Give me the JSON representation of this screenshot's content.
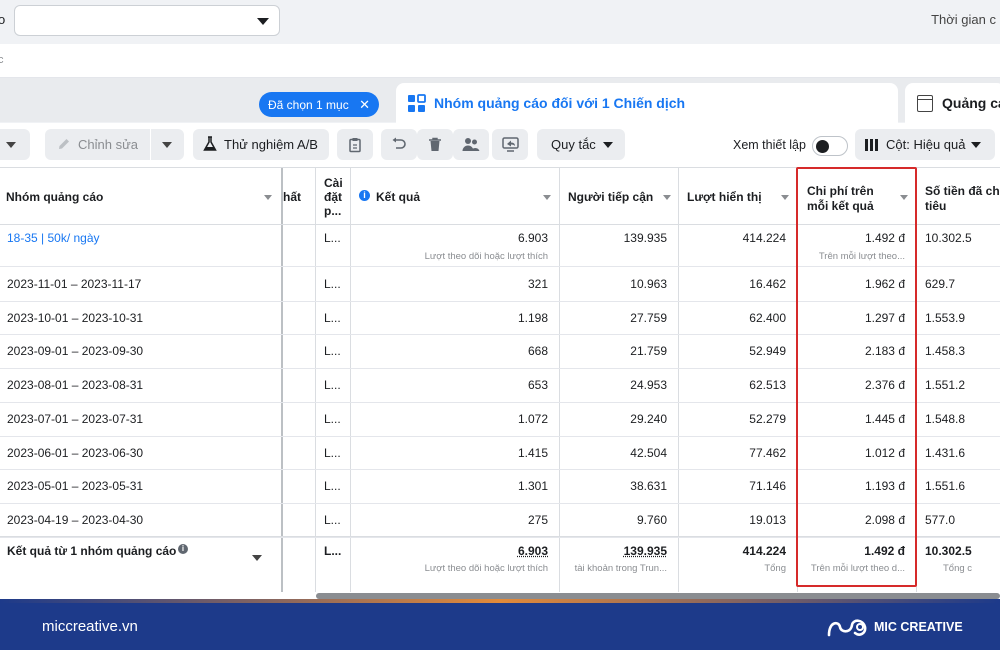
{
  "filter_bar": {
    "left_label": "o",
    "time_label": "Thời gian c",
    "sub_text": "c"
  },
  "tabs": {
    "chip_label": "Đã chọn 1 mục",
    "chip_close": "✕",
    "active_tab": "Nhóm quảng cáo đối với 1 Chiến dịch",
    "next_tab": "Quảng cá"
  },
  "toolbar": {
    "edit_label": "Chỉnh sửa",
    "ab_test_label": "Thử nghiệm A/B",
    "rules_label": "Quy tắc",
    "view_setup_label": "Xem thiết lập",
    "columns_label": "Cột: Hiệu quả"
  },
  "table": {
    "headers": {
      "name": "Nhóm quảng cáo",
      "partial": "hất",
      "settings": [
        "Cài",
        "đặt",
        "p..."
      ],
      "results": "Kết quả",
      "reach": "Người tiếp cận",
      "impressions": "Lượt hiển thị",
      "cpr": [
        "Chi phí trên",
        "mỗi kết quả"
      ],
      "spent": [
        "Số tiền đã chi",
        "tiêu"
      ]
    },
    "parent_row": {
      "name": "18-35 | 50k/ ngày",
      "settings": "L...",
      "results": "6.903",
      "results_sub": "Lượt theo dõi hoặc lượt thích",
      "reach": "139.935",
      "impressions": "414.224",
      "cpr": "1.492 đ",
      "cpr_sub": "Trên mỗi lượt theo...",
      "spent": "10.302.5"
    },
    "rows": [
      {
        "name": "2023-11-01 – 2023-11-17",
        "settings": "L...",
        "results": "321",
        "reach": "10.963",
        "impressions": "16.462",
        "cpr": "1.962 đ",
        "spent": "629.7"
      },
      {
        "name": "2023-10-01 – 2023-10-31",
        "settings": "L...",
        "results": "1.198",
        "reach": "27.759",
        "impressions": "62.400",
        "cpr": "1.297 đ",
        "spent": "1.553.9"
      },
      {
        "name": "2023-09-01 – 2023-09-30",
        "settings": "L...",
        "results": "668",
        "reach": "21.759",
        "impressions": "52.949",
        "cpr": "2.183 đ",
        "spent": "1.458.3"
      },
      {
        "name": "2023-08-01 – 2023-08-31",
        "settings": "L...",
        "results": "653",
        "reach": "24.953",
        "impressions": "62.513",
        "cpr": "2.376 đ",
        "spent": "1.551.2"
      },
      {
        "name": "2023-07-01 – 2023-07-31",
        "settings": "L...",
        "results": "1.072",
        "reach": "29.240",
        "impressions": "52.279",
        "cpr": "1.445 đ",
        "spent": "1.548.8"
      },
      {
        "name": "2023-06-01 – 2023-06-30",
        "settings": "L...",
        "results": "1.415",
        "reach": "42.504",
        "impressions": "77.462",
        "cpr": "1.012 đ",
        "spent": "1.431.6"
      },
      {
        "name": "2023-05-01 – 2023-05-31",
        "settings": "L...",
        "results": "1.301",
        "reach": "38.631",
        "impressions": "71.146",
        "cpr": "1.193 đ",
        "spent": "1.551.6"
      },
      {
        "name": "2023-04-19 – 2023-04-30",
        "settings": "L...",
        "results": "275",
        "reach": "9.760",
        "impressions": "19.013",
        "cpr": "2.098 đ",
        "spent": "577.0"
      }
    ],
    "summary": {
      "name": "Kết quả từ 1 nhóm quảng cáo",
      "settings": "L...",
      "results": "6.903",
      "results_sub": "Lượt theo dõi hoặc lượt thích",
      "reach": "139.935",
      "reach_sub": "tài khoản trong Trun...",
      "impressions": "414.224",
      "impressions_sub": "Tổng",
      "cpr": "1.492 đ",
      "cpr_sub": "Trên mỗi lượt theo d...",
      "spent": "10.302.5",
      "spent_sub": "Tổng c"
    }
  },
  "footer": {
    "website": "miccreative.vn",
    "brand": "MIC CREATIVE"
  },
  "colors": {
    "accent": "#1877f2",
    "highlight": "#d62a2a",
    "footer_bg": "#1d3a8a"
  }
}
